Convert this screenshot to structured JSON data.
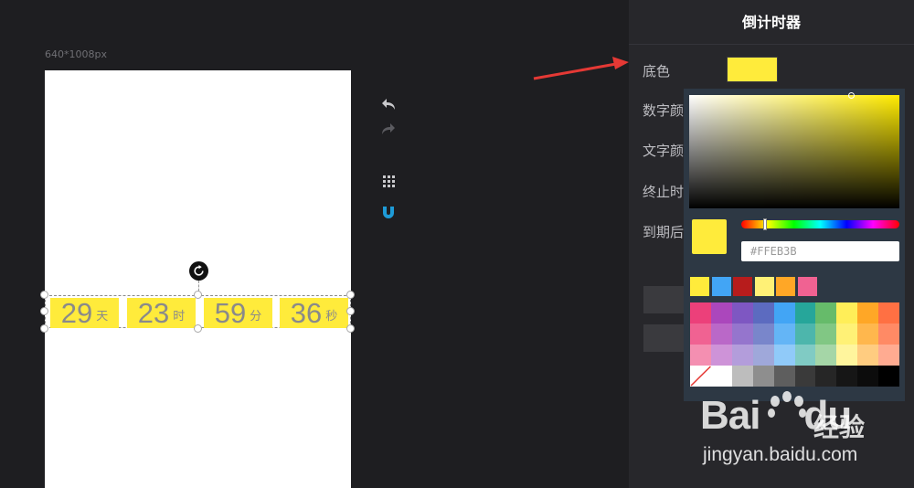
{
  "canvas": {
    "size_label": "640*1008px",
    "background": "#ffffff"
  },
  "countdown": {
    "cells": [
      {
        "value": "29",
        "unit": "天"
      },
      {
        "value": "23",
        "unit": "时"
      },
      {
        "value": "59",
        "unit": "分"
      },
      {
        "value": "36",
        "unit": "秒"
      }
    ],
    "cell_color": "#ffeb3b",
    "text_color": "#8a8a8a"
  },
  "toolbar": {
    "icons": [
      "undo-icon",
      "redo-icon",
      "grid-icon",
      "magnet-icon"
    ],
    "active_color": "#1e9bd7"
  },
  "panel": {
    "title": "倒计时器",
    "labels": {
      "bg_color": "底色",
      "num_color": "数字颜",
      "text_color": "文字颜",
      "end_time": "终止时",
      "expire": "到期后"
    },
    "bg_color_value": "#ffeb3b"
  },
  "color_picker": {
    "hex_value": "#FFEB3B",
    "recent": [
      "#ffeb3b",
      "#42a5f5",
      "#b71c1c",
      "#fff176",
      "#ffa726",
      "#f06292"
    ],
    "palette": [
      [
        "#ec407a",
        "#ab47bc",
        "#7e57c2",
        "#5c6bc0",
        "#42a5f5",
        "#26a69a",
        "#66bb6a",
        "#ffee58",
        "#ffa726",
        "#ff7043"
      ],
      [
        "#f06292",
        "#ba68c8",
        "#9575cd",
        "#7986cb",
        "#64b5f6",
        "#4db6ac",
        "#81c784",
        "#fff176",
        "#ffb74d",
        "#ff8a65"
      ],
      [
        "#f48fb1",
        "#ce93d8",
        "#b39ddb",
        "#9fa8da",
        "#90caf9",
        "#80cbc4",
        "#a5d6a7",
        "#fff59d",
        "#ffcc80",
        "#ffab91"
      ],
      [
        "none",
        "#ffffff",
        "#bdbdbd",
        "#8e8e8e",
        "#5e5e5e",
        "#3a3a3a",
        "#262626",
        "#161616",
        "#0c0c0c",
        "#000000"
      ]
    ]
  },
  "watermark": {
    "logo": "Bai",
    "logo_end": "du",
    "brand_cn": "经验",
    "url": "jingyan.baidu.com"
  }
}
